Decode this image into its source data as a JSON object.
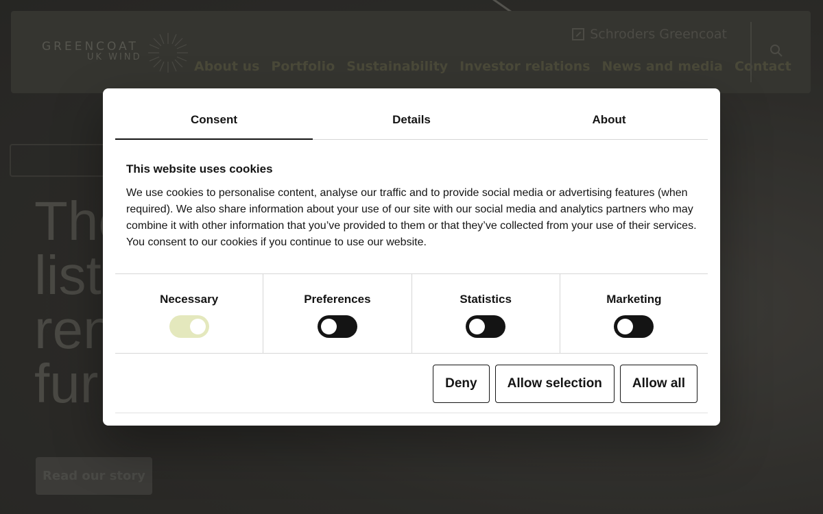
{
  "background": {
    "logo": {
      "main": "GREENCOAT",
      "sub": "UK WIND"
    },
    "brand_link": "Schroders Greencoat",
    "nav": [
      "About us",
      "Portfolio",
      "Sustainability",
      "Investor relations",
      "News and media",
      "Contact"
    ],
    "hero_lines": [
      "The",
      "list",
      "ren",
      "fur"
    ],
    "read_story": "Read our story"
  },
  "dialog": {
    "tabs": [
      {
        "label": "Consent",
        "active": true
      },
      {
        "label": "Details",
        "active": false
      },
      {
        "label": "About",
        "active": false
      }
    ],
    "heading": "This website uses cookies",
    "body": "We use cookies to personalise content, analyse our traffic and to provide social media or advertising features (when required). We also share information about your use of our site with our social media and analytics partners who may combine it with other information that you’ve provided to them or that they’ve collected from your use of their services. You consent to our cookies if you continue to use our website.",
    "categories": [
      {
        "label": "Necessary",
        "enabled": true
      },
      {
        "label": "Preferences",
        "enabled": false
      },
      {
        "label": "Statistics",
        "enabled": false
      },
      {
        "label": "Marketing",
        "enabled": false
      }
    ],
    "buttons": {
      "deny": "Deny",
      "allow_selection": "Allow selection",
      "allow_all": "Allow all"
    }
  },
  "colors": {
    "toggle_on": "#e4e8bd",
    "toggle_off": "#141414",
    "overlay": "#3a3935"
  }
}
